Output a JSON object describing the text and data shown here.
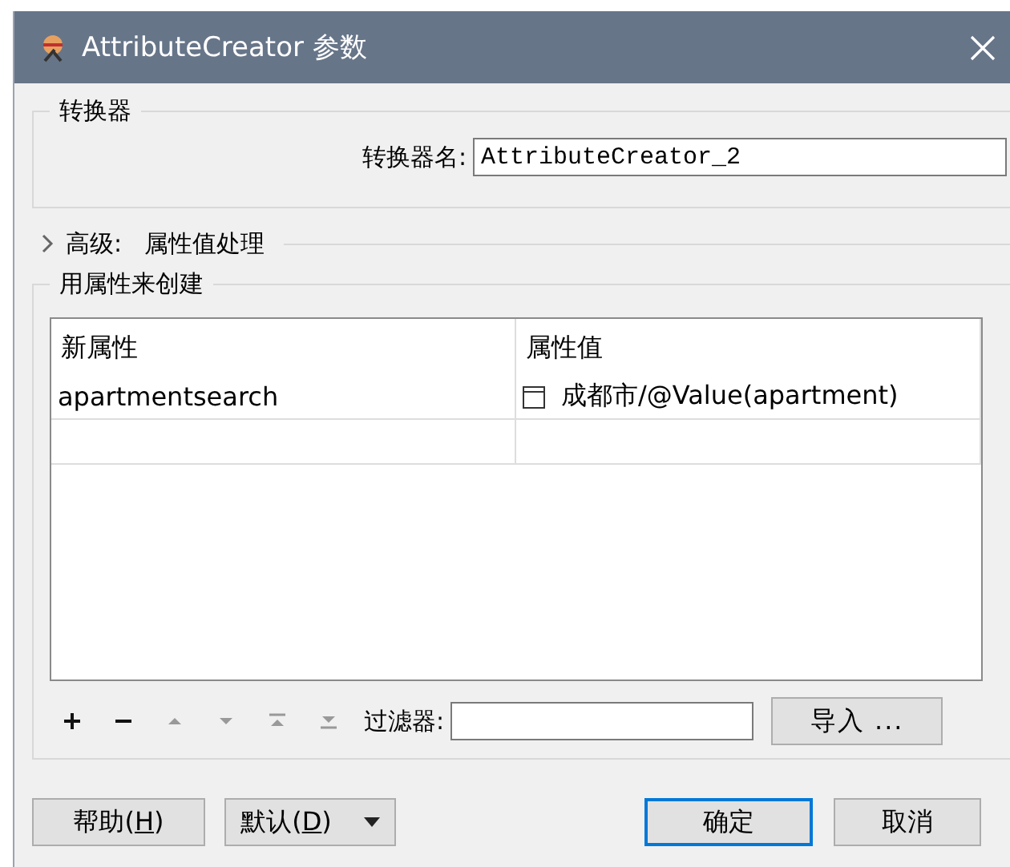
{
  "window": {
    "title": "AttributeCreator 参数"
  },
  "transformer_group": {
    "legend": "转换器",
    "name_label": "转换器名:",
    "name_value": "AttributeCreator_2"
  },
  "advanced": {
    "label": "高级:",
    "value": "属性值处理",
    "expanded": false
  },
  "create_group": {
    "legend": "用属性来创建",
    "table": {
      "columns": [
        "新属性",
        "属性值"
      ],
      "rows": [
        {
          "cells": [
            "apartmentsearch",
            "成都市/@Value(apartment)"
          ]
        },
        {
          "cells": [
            "",
            ""
          ]
        }
      ]
    },
    "tools": [
      {
        "kind": "add",
        "disabled": false
      },
      {
        "kind": "remove",
        "disabled": false
      },
      {
        "kind": "up",
        "disabled": true
      },
      {
        "kind": "down",
        "disabled": true
      },
      {
        "kind": "top",
        "disabled": true
      },
      {
        "kind": "bottom",
        "disabled": true
      }
    ],
    "filter_label": "过滤器:",
    "import_button": "导入 ..."
  },
  "buttons": [
    {
      "kind": "help",
      "before": "帮助(",
      "key": "H",
      "after": ")",
      "default": false
    },
    {
      "kind": "dropdown",
      "before": "默认(",
      "key": "D",
      "after": ")",
      "default": false
    },
    {
      "kind": "ok",
      "label": "确定",
      "default": true
    },
    {
      "kind": "cancel",
      "label": "取消",
      "default": false
    }
  ]
}
